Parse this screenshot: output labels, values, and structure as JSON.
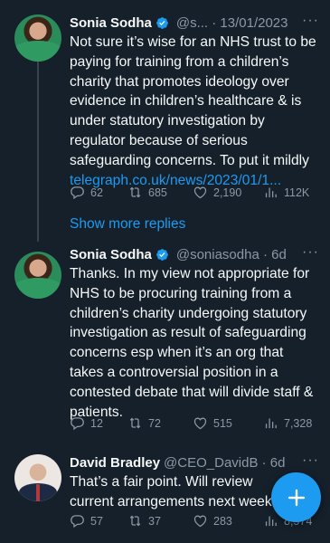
{
  "tweets": [
    {
      "name": "Sonia Sodha",
      "handle": "@s... · 13/01/2023",
      "more": "···",
      "text": "Not sure it’s wise for an NHS trust to be paying for training from a children’s charity that promotes ideology over evidence in children’s healthcare & is under statutory investigation by regulator because of serious safeguarding concerns. To put it mildly",
      "link": "telegraph.co.uk/news/2023/01/1...",
      "replies": "62",
      "retweets": "685",
      "likes": "2,190",
      "views": "112K"
    },
    {
      "name": "Sonia Sodha",
      "handle": "@soniasodha · 6d",
      "more": "···",
      "text": "Thanks. In my view not appropriate for NHS to be procuring training from a children’s charity undergoing statutory investigation as result of safeguarding concerns esp when it’s an org that takes a controversial position in a contested debate that will divide staff & patients.",
      "replies": "12",
      "retweets": "72",
      "likes": "515",
      "views": "7,328"
    },
    {
      "name": "David Bradley",
      "handle": "@CEO_DavidB · 6d",
      "more": "···",
      "text": "That’s a fair point. Will review current arrangements next week.",
      "replies": "57",
      "retweets": "37",
      "likes": "283",
      "views": "8,574"
    }
  ],
  "show_more_replies": "Show more replies",
  "colors": {
    "background": "#15202b",
    "accent": "#1d9bf0",
    "muted": "#8b98a5"
  },
  "icons": [
    "verified-badge-icon",
    "reply-icon",
    "retweet-icon",
    "like-icon",
    "views-icon",
    "compose-plus-icon"
  ]
}
